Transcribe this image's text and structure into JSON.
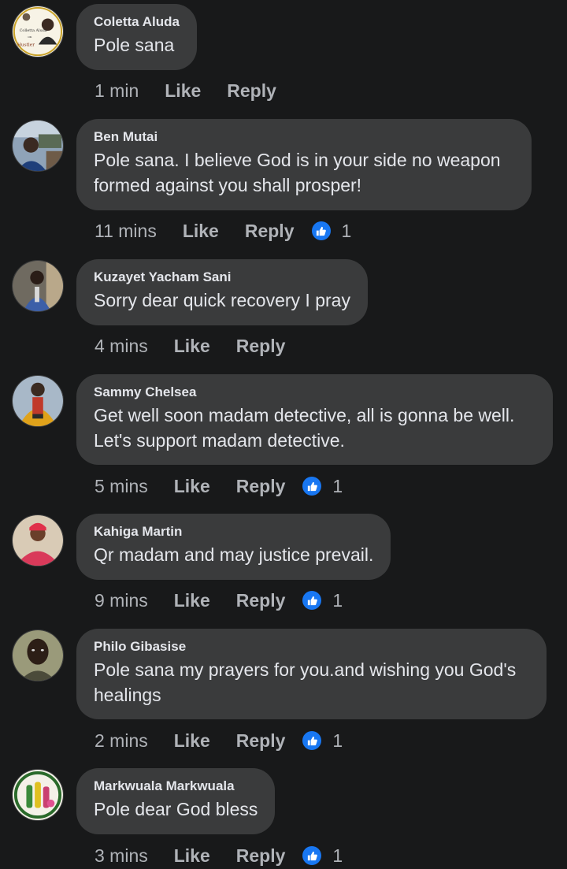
{
  "comments": [
    {
      "author": "Coletta Aluda",
      "text": [
        "Pole sana"
      ],
      "time": "1 min",
      "like_label": "Like",
      "reply_label": "Reply",
      "reactions": null,
      "avatar_text": [
        "Colletta Aluda",
        "on",
        "Hustler"
      ]
    },
    {
      "author": "Ben Mutai",
      "text": [
        "Pole sana. I believe God is in your side no weapon",
        "formed against you shall prosper!"
      ],
      "time": "11 mins",
      "like_label": "Like",
      "reply_label": "Reply",
      "reactions": "1"
    },
    {
      "author": "Kuzayet Yacham Sani",
      "text": [
        "Sorry dear quick recovery I pray"
      ],
      "time": "4 mins",
      "like_label": "Like",
      "reply_label": "Reply",
      "reactions": null
    },
    {
      "author": "Sammy Chelsea",
      "text": [
        "Get well soon madam detective, all is gonna be well.",
        "Let's support madam detective."
      ],
      "time": "5 mins",
      "like_label": "Like",
      "reply_label": "Reply",
      "reactions": "1"
    },
    {
      "author": "Kahiga Martin",
      "text": [
        "Qr madam and may justice prevail."
      ],
      "time": "9 mins",
      "like_label": "Like",
      "reply_label": "Reply",
      "reactions": "1"
    },
    {
      "author": "Philo Gibasise",
      "text": [
        "Pole sana my prayers for you.and wishing you God's",
        "healings"
      ],
      "time": "2 mins",
      "like_label": "Like",
      "reply_label": "Reply",
      "reactions": "1"
    },
    {
      "author": "Markwuala Markwuala",
      "text": [
        "Pole dear God bless"
      ],
      "time": "3 mins",
      "like_label": "Like",
      "reply_label": "Reply",
      "reactions": "1"
    }
  ],
  "colors": {
    "background": "#18191a",
    "bubble": "#3a3b3c",
    "text_primary": "#e4e6eb",
    "text_secondary": "#b0b3b8",
    "like_blue": "#1877f2"
  },
  "icons": {
    "reaction": "thumbs-up-icon"
  }
}
